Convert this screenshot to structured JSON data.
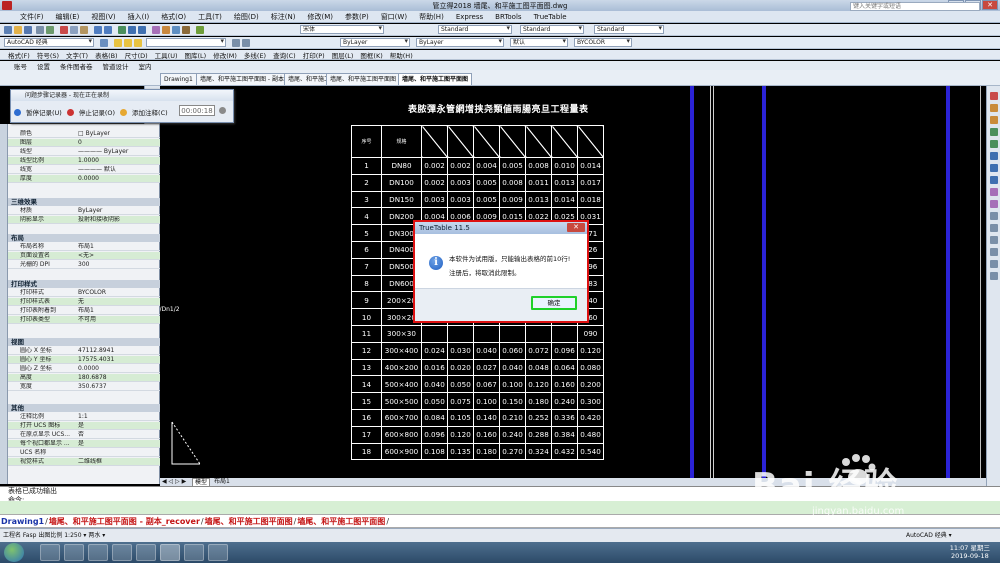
{
  "window": {
    "title": "管立得2018      墙尾、和平施工图平面图.dwg",
    "search_placeholder": "键入关键字或短语"
  },
  "menubar": [
    "文件(F)",
    "编辑(E)",
    "视图(V)",
    "插入(I)",
    "格式(O)",
    "工具(T)",
    "绘图(D)",
    "标注(N)",
    "修改(M)",
    "参数(P)",
    "窗口(W)",
    "帮助(H)",
    "Express",
    "BRTools",
    "TrueTable"
  ],
  "toolbar2": {
    "workspace": "AutoCAD 经典",
    "text_style": "宋体",
    "dim_style": "Standard",
    "table_style": "Standard",
    "multileader_style": "Standard"
  },
  "toolbar3": {
    "layer_combo": "ByLayer",
    "linetype_combo": "ByLayer",
    "lineweight_combo": "默认",
    "plotstyle_combo": "BYCOLOR"
  },
  "toolbar4": {
    "menus": [
      "格式(F)",
      "符号(S)",
      "文字(T)",
      "表格(B)",
      "尺寸(D)",
      "工具(U)",
      "图库(L)",
      "修改(M)",
      "多线(E)",
      "查询(C)",
      "打印(P)",
      "图层(L)",
      "图框(K)",
      "帮助(H)"
    ]
  },
  "ribbon_row": {
    "items": [
      "账号",
      "设置",
      "条件图者卷",
      "管道设计",
      "室内"
    ]
  },
  "doc_tabs": [
    "Drawing1",
    "墙尾、和平施工图平面图 - 副本_rec",
    "墙尾、和平施工图平面图 - 副本_recover",
    "墙尾、和平施工图平面图",
    "墙尾、和平施工图平面图"
  ],
  "recorder": {
    "title": "问题步骤记录器 - 现在正在录制",
    "pause_label": "暂停记录(U)",
    "stop_label": "停止记录(O)",
    "add_label": "添加注释(C)",
    "timer": "00:00:18"
  },
  "properties": {
    "rows_general": [
      {
        "k": "颜色",
        "v": "□ ByLayer"
      },
      {
        "k": "图层",
        "v": "0"
      },
      {
        "k": "线型",
        "v": "———— ByLayer"
      },
      {
        "k": "线型比例",
        "v": "1.0000"
      },
      {
        "k": "线宽",
        "v": "———— 默认"
      },
      {
        "k": "厚度",
        "v": "0.0000"
      }
    ],
    "sect_3d": "三维效果",
    "rows_3d": [
      {
        "k": "材质",
        "v": "ByLayer"
      },
      {
        "k": "阴影显示",
        "v": "投射和接收阴影"
      }
    ],
    "sect_layout": "布局",
    "rows_layout": [
      {
        "k": "布局名称",
        "v": "布局1"
      },
      {
        "k": "页面设置名",
        "v": "<无>"
      },
      {
        "k": "光栅的 DPI",
        "v": "300"
      }
    ],
    "sect_plot": "打印样式",
    "rows_plot": [
      {
        "k": "打印样式",
        "v": "BYCOLOR"
      },
      {
        "k": "打印样式表",
        "v": "无"
      },
      {
        "k": "打印表附着到",
        "v": "布局1"
      },
      {
        "k": "打印表类型",
        "v": "不可用"
      }
    ],
    "sect_view": "视图",
    "rows_view": [
      {
        "k": "圆心 X 坐标",
        "v": "47112.8941"
      },
      {
        "k": "圆心 Y 坐标",
        "v": "17575.4031"
      },
      {
        "k": "圆心 Z 坐标",
        "v": "0.0000"
      },
      {
        "k": "高度",
        "v": "180.6878"
      },
      {
        "k": "宽度",
        "v": "350.6737"
      }
    ],
    "sect_misc": "其他",
    "rows_misc": [
      {
        "k": "注释比例",
        "v": "1:1"
      },
      {
        "k": "打开 UCS 图标",
        "v": "是"
      },
      {
        "k": "在原点显示 UCS...",
        "v": "否"
      },
      {
        "k": "每个视口都显示 ...",
        "v": "是"
      },
      {
        "k": "UCS 名称",
        "v": ""
      },
      {
        "k": "视觉样式",
        "v": "二维线框"
      }
    ]
  },
  "drawing": {
    "table_title": "表脓彈永管網增挟尧類値雨腸亮旦工程量表",
    "side_label": "k/Dn1/2",
    "header": [
      "序号",
      "规格",
      "",
      "",
      "",
      "",
      "",
      "",
      ""
    ],
    "rows": [
      [
        "1",
        "DN80",
        "0.002",
        "0.002",
        "0.004",
        "0.005",
        "0.008",
        "0.010",
        "0.014"
      ],
      [
        "2",
        "DN100",
        "0.002",
        "0.003",
        "0.005",
        "0.008",
        "0.011",
        "0.013",
        "0.017"
      ],
      [
        "3",
        "DN150",
        "0.003",
        "0.003",
        "0.005",
        "0.009",
        "0.013",
        "0.014",
        "0.018"
      ],
      [
        "4",
        "DN200",
        "0.004",
        "0.006",
        "0.009",
        "0.015",
        "0.022",
        "0.025",
        "0.031"
      ],
      [
        "5",
        "DN300",
        "",
        "",
        "",
        "",
        "",
        "",
        "071"
      ],
      [
        "6",
        "DN400",
        "",
        "",
        "",
        "",
        "",
        "",
        "126"
      ],
      [
        "7",
        "DN500",
        "",
        "",
        "",
        "",
        "",
        "",
        "196"
      ],
      [
        "8",
        "DN600",
        "",
        "",
        "",
        "",
        "",
        "",
        "283"
      ],
      [
        "9",
        "200×20",
        "",
        "",
        "",
        "",
        "",
        "",
        "040"
      ],
      [
        "10",
        "300×20",
        "",
        "",
        "",
        "",
        "",
        "",
        "060"
      ],
      [
        "11",
        "300×30",
        "",
        "",
        "",
        "",
        "",
        "",
        "090"
      ],
      [
        "12",
        "300×400",
        "0.024",
        "0.030",
        "0.040",
        "0.060",
        "0.072",
        "0.096",
        "0.120"
      ],
      [
        "13",
        "400×200",
        "0.016",
        "0.020",
        "0.027",
        "0.040",
        "0.048",
        "0.064",
        "0.080"
      ],
      [
        "14",
        "500×400",
        "0.040",
        "0.050",
        "0.067",
        "0.100",
        "0.120",
        "0.160",
        "0.200"
      ],
      [
        "15",
        "500×500",
        "0.050",
        "0.075",
        "0.100",
        "0.150",
        "0.180",
        "0.240",
        "0.300"
      ],
      [
        "16",
        "600×700",
        "0.084",
        "0.105",
        "0.140",
        "0.210",
        "0.252",
        "0.336",
        "0.420"
      ],
      [
        "17",
        "600×800",
        "0.096",
        "0.120",
        "0.160",
        "0.240",
        "0.288",
        "0.384",
        "0.480"
      ],
      [
        "18",
        "600×900",
        "0.108",
        "0.135",
        "0.180",
        "0.270",
        "0.324",
        "0.432",
        "0.540"
      ]
    ]
  },
  "modal": {
    "title": "TrueTable 11.5",
    "close": "✕",
    "message1": "本软件为试用版，只能输出表格的前10行!",
    "message2": "注册后，将取消此限制。",
    "ok_label": "确定"
  },
  "layout_tabs": [
    "模型",
    "布局1"
  ],
  "command": {
    "line1": "表格已成功输出",
    "line2": "命令:"
  },
  "bottom_tabs": [
    "Drawing1",
    "墙尾、和平施工图平面图 - 副本_recover",
    "墙尾、和平施工图平面图",
    "墙尾、和平施工图平面图"
  ],
  "status": {
    "left": "工程名 Fasp  出图比例 1:250  ▾  两水 ▾",
    "right": "AutoCAD 经典 ▾"
  },
  "clock": {
    "time": "11:07 星期三",
    "date": "2019-09-18"
  },
  "watermark": {
    "brand": "Bai  经验",
    "url": "jingyan.baidu.com"
  },
  "colors": {
    "dialog_border": "#dd1111",
    "ok_highlight": "#1fd12a",
    "drawing_bg": "#000000",
    "tab_red": "#c41414"
  }
}
